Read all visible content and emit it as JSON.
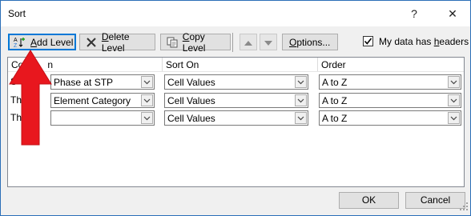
{
  "window": {
    "title": "Sort",
    "help_glyph": "?",
    "close_glyph": "✕"
  },
  "toolbar": {
    "add_level": {
      "prefix": "",
      "accel": "A",
      "rest": "dd Level",
      "icon": "add-level-icon"
    },
    "delete_level": {
      "accel": "D",
      "rest": "elete Level",
      "icon": "delete-x-icon"
    },
    "copy_level": {
      "accel": "C",
      "rest": "opy Level",
      "icon": "copy-icon"
    },
    "move_up": {
      "icon": "triangle-up-icon"
    },
    "move_down": {
      "icon": "triangle-down-icon"
    },
    "options": {
      "accel": "O",
      "rest": "ptions..."
    },
    "headers_checkbox": {
      "checked": true,
      "label_pre": "My data has ",
      "accel": "h",
      "label_post": "eaders"
    }
  },
  "grid": {
    "columns": [
      "Column",
      "Sort On",
      "Order"
    ],
    "column_visible": "Co",
    "column_visible_tail": "n",
    "rows": [
      {
        "label_visible": "S",
        "column": "Phase at STP",
        "sort_on": "Cell Values",
        "order": "A to Z"
      },
      {
        "label_visible": "Th",
        "column": "Element Category",
        "sort_on": "Cell Values",
        "order": "A to Z"
      },
      {
        "label_visible": "Th",
        "column": "",
        "sort_on": "Cell Values",
        "order": "A to Z"
      }
    ]
  },
  "footer": {
    "ok": "OK",
    "cancel": "Cancel"
  },
  "colors": {
    "accent": "#0078d7",
    "annotation_arrow": "#e8171e"
  }
}
